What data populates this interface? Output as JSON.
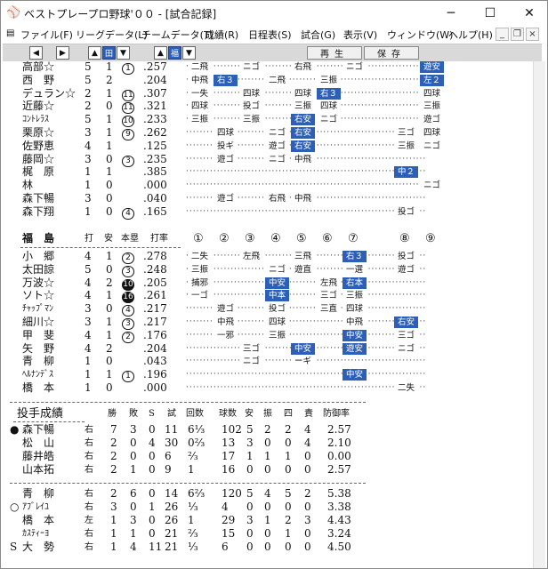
{
  "window": {
    "title": "ベストプレープロ野球'００ - [試合記録]",
    "app_icon": "baseball-cap-icon"
  },
  "menu": [
    "ファイル(F)",
    "リーグデータ(L)",
    "チームデータ(T)",
    "成績(R)",
    "日程表(S)",
    "試合(G)",
    "表示(V)",
    "ウィンドウ(W)",
    "ヘルプ(H)"
  ],
  "toolbar": {
    "team_home": "田",
    "team_away": "福",
    "replay": "再生",
    "save": "保存"
  },
  "team1": {
    "rows": [
      {
        "name": "高部☆",
        "ab": "5",
        "h": "1",
        "rbi": "1",
        "avg": ".257",
        "cells": [
          "二飛",
          "",
          "ニゴ",
          "",
          "右飛",
          "",
          "ニゴ",
          "",
          "遊安"
        ],
        "hl": [
          8
        ]
      },
      {
        "name": "西　野",
        "ab": "5",
        "h": "2",
        "rbi": "",
        "avg": ".204",
        "cells": [
          "中飛",
          "右３",
          "",
          "二飛",
          "",
          "三振",
          "",
          "",
          "左２"
        ],
        "hl": [
          1,
          8
        ]
      },
      {
        "name": "デュラン☆",
        "ab": "2",
        "h": "1",
        "rbi": "11",
        "avg": ".307",
        "cells": [
          "一失",
          "",
          "四球",
          "",
          "四球",
          "右３",
          "",
          "",
          "四球"
        ],
        "hl": [
          5
        ]
      },
      {
        "name": "近藤☆",
        "ab": "2",
        "h": "0",
        "rbi": "11",
        "avg": ".321",
        "cells": [
          "四球",
          "",
          "投ゴ",
          "",
          "三振",
          "四球",
          "",
          "",
          "三振"
        ],
        "hl": []
      },
      {
        "name": "ｺﾝﾄﾚﾗｽ",
        "ab": "5",
        "h": "1",
        "rbi": "10",
        "avg": ".233",
        "cells": [
          "三振",
          "",
          "三振",
          "",
          "右安",
          "ニゴ",
          "",
          "",
          "遊ゴ"
        ],
        "hl": [
          4
        ]
      },
      {
        "name": "栗原☆",
        "ab": "3",
        "h": "1",
        "rbi": "9",
        "avg": ".262",
        "cells": [
          "",
          "四球",
          "",
          "ニゴ",
          "右安",
          "",
          "",
          "三ゴ",
          "四球"
        ],
        "hl": [
          4
        ]
      },
      {
        "name": "佐野恵",
        "ab": "4",
        "h": "1",
        "rbi": "",
        "avg": ".125",
        "cells": [
          "",
          "投ギ",
          "",
          "遊ゴ",
          "右安",
          "",
          "",
          "三振",
          "ニゴ"
        ],
        "hl": [
          4
        ]
      },
      {
        "name": "藤岡☆",
        "ab": "3",
        "h": "0",
        "rbi": "3",
        "avg": ".235",
        "cells": [
          "",
          "遊ゴ",
          "",
          "ニゴ",
          "中飛",
          "",
          "",
          "",
          ""
        ],
        "hl": []
      },
      {
        "name": "梶　原",
        "ab": "1",
        "h": "1",
        "rbi": "",
        "avg": ".385",
        "cells": [
          "",
          "",
          "",
          "",
          "",
          "",
          "",
          "中２",
          ""
        ],
        "hl": [
          7
        ]
      },
      {
        "name": "林",
        "ab": "1",
        "h": "0",
        "rbi": "",
        "avg": ".000",
        "cells": [
          "",
          "",
          "",
          "",
          "",
          "",
          "",
          "",
          "ニゴ"
        ],
        "hl": []
      },
      {
        "name": "森下暢",
        "ab": "3",
        "h": "0",
        "rbi": "",
        "avg": ".040",
        "cells": [
          "",
          "遊ゴ",
          "",
          "右飛",
          "中飛",
          "",
          "",
          "",
          ""
        ],
        "hl": []
      },
      {
        "name": "森下翔",
        "ab": "1",
        "h": "0",
        "rbi": "4",
        "avg": ".165",
        "cells": [
          "",
          "",
          "",
          "",
          "",
          "",
          "",
          "投ゴ",
          ""
        ],
        "hl": []
      }
    ]
  },
  "team2": {
    "header": {
      "team": "福　島",
      "ab": "打",
      "h": "安",
      "rbi": "本塁",
      "avg": "打率",
      "innings": [
        "①",
        "②",
        "③",
        "④",
        "⑤",
        "⑥",
        "⑦",
        "⑧",
        "⑨"
      ]
    },
    "rows": [
      {
        "name": "小　郷",
        "ab": "4",
        "h": "1",
        "rbi": "2",
        "rbi_filled": false,
        "avg": ".278",
        "cells": [
          "二失",
          "",
          "左飛",
          "",
          "三飛",
          "",
          "右３",
          "投ゴ",
          ""
        ],
        "hl": [
          6
        ]
      },
      {
        "name": "太田諒",
        "ab": "5",
        "h": "0",
        "rbi": "3",
        "rbi_filled": false,
        "avg": ".248",
        "cells": [
          "三振",
          "",
          "",
          "ニゴ",
          "遊直",
          "",
          "一選",
          "遊ゴ",
          ""
        ],
        "hl": []
      },
      {
        "name": "万波☆",
        "ab": "4",
        "h": "2",
        "rbi": "10",
        "rbi_filled": true,
        "avg": ".205",
        "cells": [
          "捕邪",
          "",
          "",
          "中安",
          "",
          "左飛",
          "右本",
          "",
          ""
        ],
        "hl": [
          3,
          6
        ]
      },
      {
        "name": "ソト☆",
        "ab": "4",
        "h": "1",
        "rbi": "16",
        "rbi_filled": true,
        "avg": ".261",
        "cells": [
          "一ゴ",
          "",
          "",
          "中本",
          "",
          "三ゴ",
          "三振",
          "",
          ""
        ],
        "hl": [
          3
        ]
      },
      {
        "name": "ﾁｬｯﾌﾟﾏﾝ",
        "ab": "3",
        "h": "0",
        "rbi": "4",
        "rbi_filled": false,
        "avg": ".217",
        "cells": [
          "",
          "遊ゴ",
          "",
          "投ゴ",
          "",
          "三直",
          "四球",
          "",
          ""
        ],
        "hl": []
      },
      {
        "name": "細川☆",
        "ab": "3",
        "h": "1",
        "rbi": "3",
        "rbi_filled": false,
        "avg": ".217",
        "cells": [
          "",
          "中飛",
          "",
          "四球",
          "",
          "",
          "中飛",
          "右安",
          ""
        ],
        "hl": [
          7
        ]
      },
      {
        "name": "甲　斐",
        "ab": "4",
        "h": "1",
        "rbi": "2",
        "rbi_filled": false,
        "avg": ".176",
        "cells": [
          "",
          "一邪",
          "",
          "三振",
          "",
          "",
          "中安",
          "三ゴ",
          ""
        ],
        "hl": [
          6
        ]
      },
      {
        "name": "矢　野",
        "ab": "4",
        "h": "2",
        "rbi": "",
        "rbi_filled": false,
        "avg": ".204",
        "cells": [
          "",
          "",
          "三ゴ",
          "",
          "中安",
          "",
          "遊安",
          "ニゴ",
          ""
        ],
        "hl": [
          4,
          6
        ]
      },
      {
        "name": "青　柳",
        "ab": "1",
        "h": "0",
        "rbi": "",
        "rbi_filled": false,
        "avg": ".043",
        "cells": [
          "",
          "",
          "ニゴ",
          "",
          "ーギ",
          "",
          "",
          "",
          ""
        ],
        "hl": []
      },
      {
        "name": "ﾍﾙﾅﾝﾃﾞｽ",
        "ab": "1",
        "h": "1",
        "rbi": "1",
        "rbi_filled": false,
        "avg": ".196",
        "cells": [
          "",
          "",
          "",
          "",
          "",
          "",
          "中安",
          "",
          ""
        ],
        "hl": [
          6
        ]
      },
      {
        "name": "橋　本",
        "ab": "1",
        "h": "0",
        "rbi": "",
        "rbi_filled": false,
        "avg": ".000",
        "cells": [
          "",
          "",
          "",
          "",
          "",
          "",
          "",
          "二失",
          ""
        ],
        "hl": []
      }
    ]
  },
  "pitching": {
    "title": "投手成績",
    "headers": [
      "勝",
      "敗",
      "S",
      "試",
      "回数",
      "球数",
      "安",
      "振",
      "四",
      "責",
      "防御率"
    ],
    "team1": [
      {
        "mark": "●",
        "name": "森下暢",
        "hand": "右",
        "w": "7",
        "l": "3",
        "s": "0",
        "g": "11",
        "ip": "6⅓",
        "np": "102",
        "h": "5",
        "k": "2",
        "bb": "2",
        "er": "4",
        "era": "2.57"
      },
      {
        "mark": "",
        "name": "松　山",
        "hand": "右",
        "w": "2",
        "l": "0",
        "s": "4",
        "g": "30",
        "ip": "0⅔",
        "np": "13",
        "h": "3",
        "k": "0",
        "bb": "0",
        "er": "4",
        "era": "2.10"
      },
      {
        "mark": "",
        "name": "藤井皓",
        "hand": "右",
        "w": "2",
        "l": "0",
        "s": "0",
        "g": "6",
        "ip": "⅔",
        "np": "17",
        "h": "1",
        "k": "1",
        "bb": "1",
        "er": "0",
        "era": "0.00"
      },
      {
        "mark": "",
        "name": "山本拓",
        "hand": "右",
        "w": "2",
        "l": "1",
        "s": "0",
        "g": "9",
        "ip": "1",
        "np": "16",
        "h": "0",
        "k": "0",
        "bb": "0",
        "er": "0",
        "era": "2.57"
      }
    ],
    "team2": [
      {
        "mark": "",
        "name": "青　柳",
        "hand": "右",
        "w": "2",
        "l": "6",
        "s": "0",
        "g": "14",
        "ip": "6⅔",
        "np": "120",
        "h": "5",
        "k": "4",
        "bb": "5",
        "er": "2",
        "era": "5.38"
      },
      {
        "mark": "○",
        "name": "ｱﾌﾞﾚｲﾕ",
        "hand": "右",
        "w": "3",
        "l": "0",
        "s": "1",
        "g": "26",
        "ip": "⅓",
        "np": "4",
        "h": "0",
        "k": "0",
        "bb": "0",
        "er": "0",
        "era": "3.38"
      },
      {
        "mark": "",
        "name": "橋　本",
        "hand": "左",
        "w": "1",
        "l": "3",
        "s": "0",
        "g": "26",
        "ip": "1",
        "np": "29",
        "h": "3",
        "k": "1",
        "bb": "2",
        "er": "3",
        "era": "4.43"
      },
      {
        "mark": "",
        "name": "ｶｽﾃｨｰﾖ",
        "hand": "右",
        "w": "1",
        "l": "1",
        "s": "0",
        "g": "21",
        "ip": "⅔",
        "np": "15",
        "h": "0",
        "k": "0",
        "bb": "1",
        "er": "0",
        "era": "3.24"
      },
      {
        "mark": "S",
        "name": "大　勢",
        "hand": "右",
        "w": "1",
        "l": "4",
        "s": "11",
        "g": "21",
        "ip": "⅓",
        "np": "6",
        "h": "0",
        "k": "0",
        "bb": "0",
        "er": "0",
        "era": "4.50"
      }
    ]
  }
}
